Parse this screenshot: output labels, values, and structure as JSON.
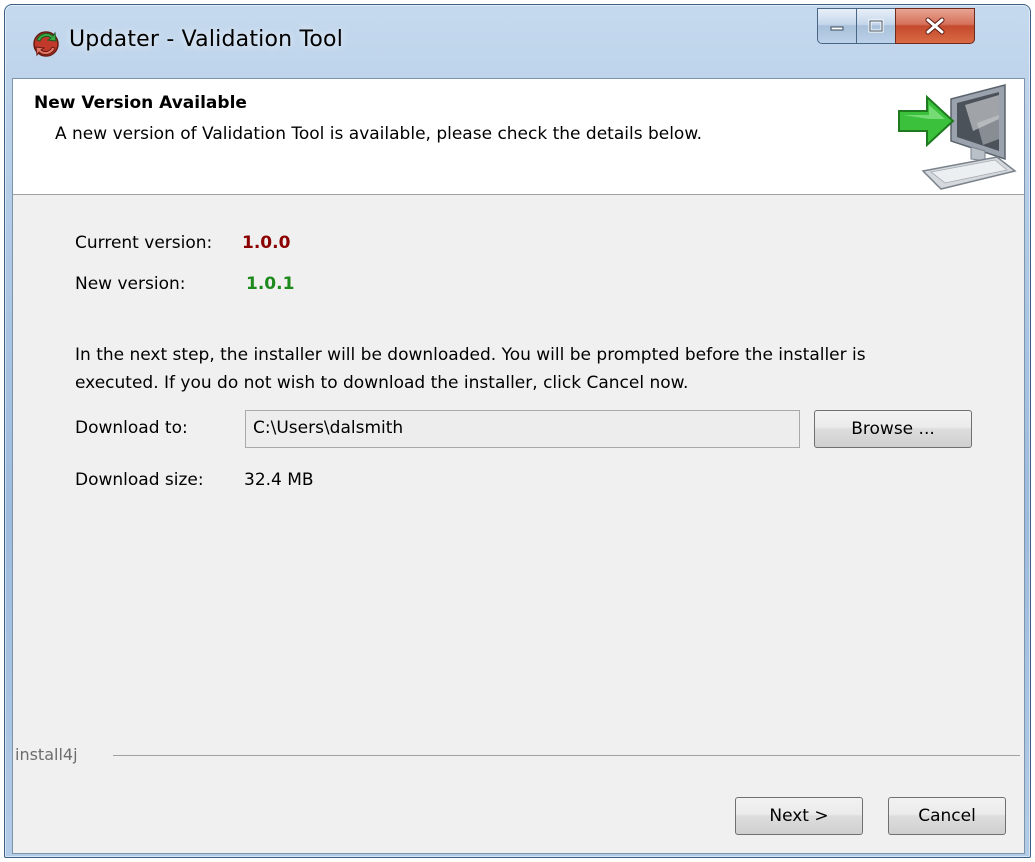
{
  "window": {
    "title": "Updater - Validation Tool",
    "icons": {
      "app": "updater-app-icon",
      "minimize": "minimize-icon",
      "maximize": "maximize-icon",
      "close": "close-icon"
    }
  },
  "header": {
    "title": "New Version Available",
    "subtitle": "A new version of Validation Tool is available, please check the details below.",
    "graphic_icon": "computer-arrow-icon"
  },
  "versions": {
    "current_label": "Current version:",
    "current_value": "1.0.0",
    "new_label": "New version:",
    "new_value": "1.0.1"
  },
  "info": {
    "line1": "In the next step, the installer will be downloaded. You will be prompted before the installer is",
    "line2": "executed. If you do not wish to download the installer, click Cancel now."
  },
  "download": {
    "to_label": "Download to:",
    "path": "C:\\Users\\dalsmith",
    "browse_label": "Browse ...",
    "size_label": "Download size:",
    "size_value": "32.4 MB"
  },
  "footer": {
    "brand": "install4j",
    "next_label": "Next >",
    "cancel_label": "Cancel"
  },
  "colors": {
    "current_version": "#8b0000",
    "new_version": "#1e8a1e"
  }
}
